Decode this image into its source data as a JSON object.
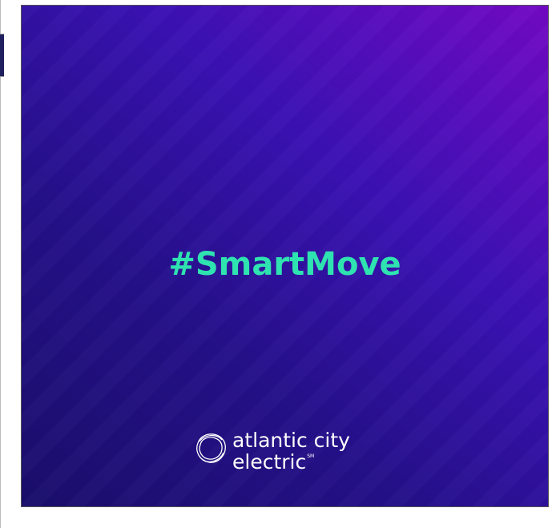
{
  "post": {
    "hashtag": "#SmartMove",
    "brand": {
      "line1": "atlantic city",
      "line2": "electric",
      "mark": "SM",
      "icon": "ring-logo-icon"
    }
  },
  "colors": {
    "background_dark": "#1a0e6b",
    "background_light": "#7209c5",
    "hashtag": "#2fe3b0",
    "logo": "#ffffff",
    "side_tab": "#1f1f5e"
  }
}
